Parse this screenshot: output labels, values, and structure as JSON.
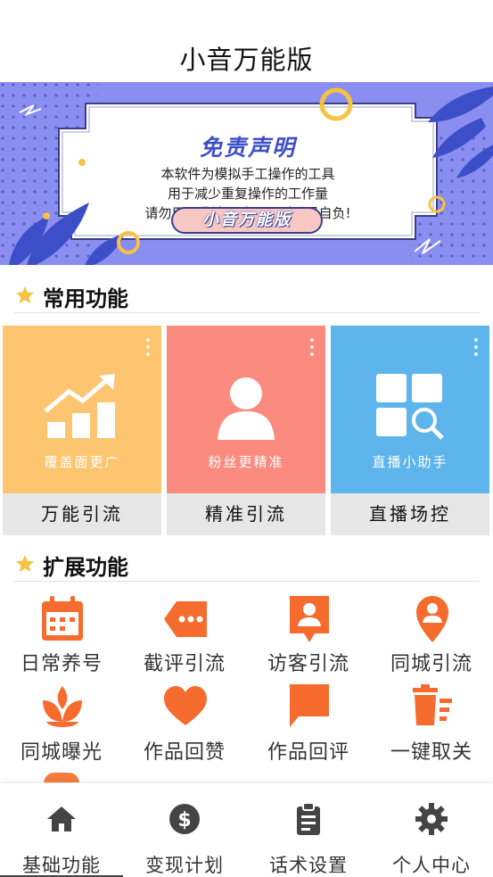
{
  "header": {
    "title": "小音万能版"
  },
  "banner": {
    "title": "免责声明",
    "lines": [
      "本软件为模拟手工操作的工具",
      "用于减少重复操作的工作量",
      "请勿用于非法用途，否则后果自负!"
    ],
    "badge": "小音万能版"
  },
  "sections": {
    "common": "常用功能",
    "extended": "扩展功能"
  },
  "cards": [
    {
      "subtitle": "覆盖面更广",
      "label": "万能引流",
      "color": "#fdc56f",
      "icon": "trend-chart-icon"
    },
    {
      "subtitle": "粉丝更精准",
      "label": "精准引流",
      "color": "#fa8b7e",
      "icon": "person-icon"
    },
    {
      "subtitle": "直播小助手",
      "label": "直播场控",
      "color": "#5eb5ec",
      "icon": "grid-search-icon"
    }
  ],
  "extended_items": [
    {
      "label": "日常养号",
      "icon": "calendar-icon"
    },
    {
      "label": "截评引流",
      "icon": "tag-dots-icon"
    },
    {
      "label": "访客引流",
      "icon": "person-card-icon"
    },
    {
      "label": "同城引流",
      "icon": "location-pin-icon"
    },
    {
      "label": "同城曝光",
      "icon": "lotus-icon"
    },
    {
      "label": "作品回赞",
      "icon": "heart-icon"
    },
    {
      "label": "作品回评",
      "icon": "chat-bubble-icon"
    },
    {
      "label": "一键取关",
      "icon": "delete-list-icon"
    }
  ],
  "bottom_nav": [
    {
      "label": "基础功能",
      "icon": "home-icon",
      "active": true
    },
    {
      "label": "变现计划",
      "icon": "dollar-coin-icon",
      "active": false
    },
    {
      "label": "话术设置",
      "icon": "clipboard-icon",
      "active": false
    },
    {
      "label": "个人中心",
      "icon": "gear-icon",
      "active": false
    }
  ],
  "colors": {
    "accent": "#f66b2e",
    "banner": "#8a8ef0",
    "star": "#f6c343"
  }
}
